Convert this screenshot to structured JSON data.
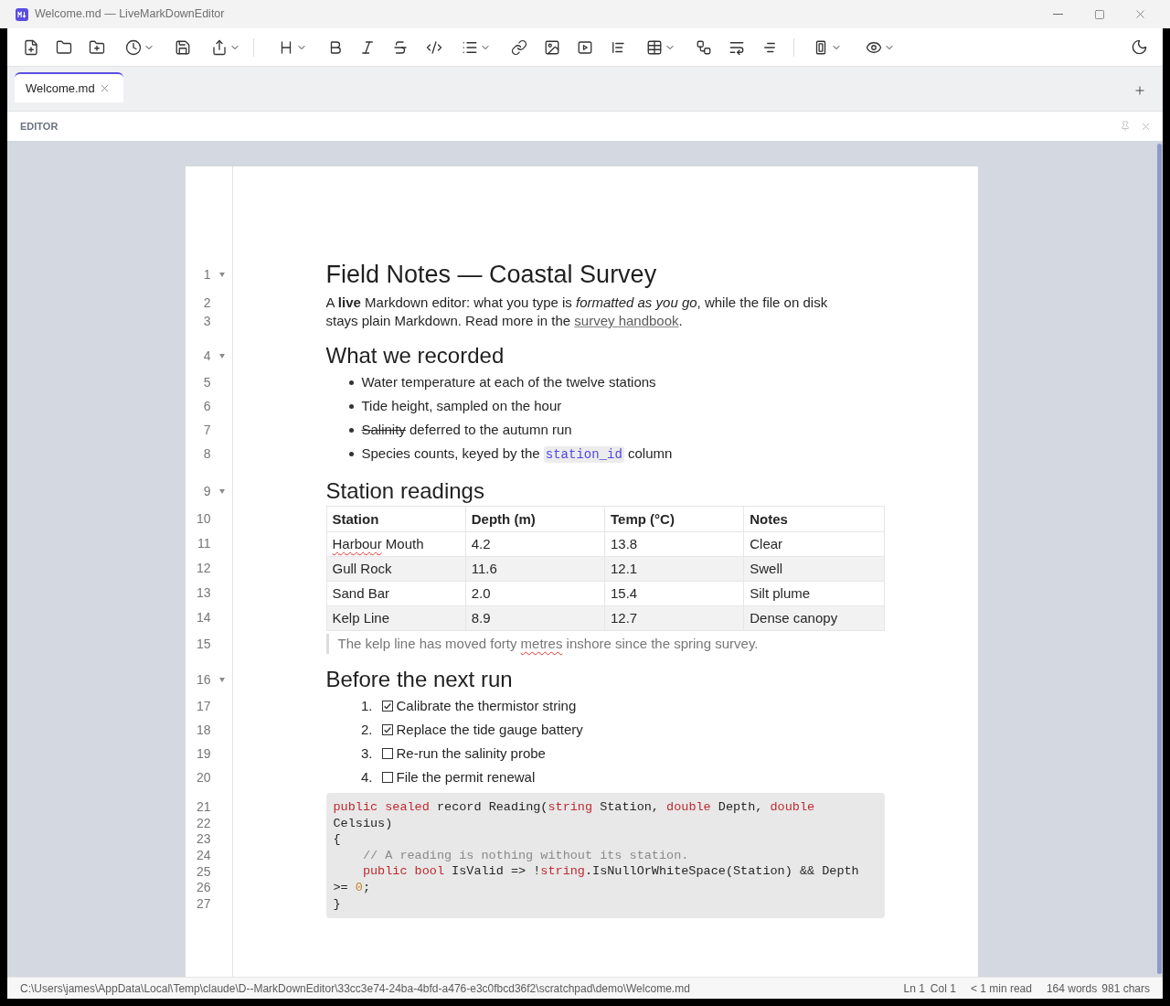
{
  "window": {
    "title": "Welcome.md — LiveMarkDownEditor"
  },
  "tabs": [
    {
      "label": "Welcome.md",
      "selected": true
    }
  ],
  "panel": {
    "title": "EDITOR"
  },
  "document": {
    "blocks": [
      {
        "kind": "heading1",
        "line": "1",
        "expanded": true,
        "text": "Field Notes — Coastal Survey"
      },
      {
        "kind": "paragraph",
        "rows": [
          {
            "line": "2",
            "segments": [
              {
                "kind": "text",
                "text": "A **live** Markdown editor: what you type is *formatted as you go*, while the file on disk"
              }
            ]
          },
          {
            "line": "3",
            "segments": [
              {
                "kind": "text",
                "text": "stays plain Markdown. Read more in the "
              },
              {
                "kind": "link",
                "text": "survey handbook"
              },
              {
                "kind": "text",
                "text": "."
              }
            ]
          }
        ]
      },
      {
        "kind": "heading2",
        "line": "4",
        "expanded": true,
        "text": "What we recorded"
      },
      {
        "kind": "bullet_list",
        "items": [
          {
            "line": "5",
            "segments": [
              {
                "kind": "text",
                "text": "Water temperature at each of the twelve stations"
              }
            ]
          },
          {
            "line": "6",
            "segments": [
              {
                "kind": "text",
                "text": "Tide height, sampled on the hour"
              }
            ]
          },
          {
            "line": "7",
            "segments": [
              {
                "kind": "strike",
                "text": "Salinity"
              },
              {
                "kind": "text",
                "text": " deferred to the autumn run"
              }
            ]
          },
          {
            "line": "8",
            "segments": [
              {
                "kind": "text",
                "text": "Species counts, keyed by the "
              },
              {
                "kind": "code",
                "text": "station_id"
              },
              {
                "kind": "text",
                "text": " column"
              }
            ]
          }
        ]
      },
      {
        "kind": "heading2",
        "line": "9",
        "expanded": true,
        "text": "Station readings"
      },
      {
        "kind": "table",
        "line": "10",
        "columns": [
          "Station",
          "Depth (m)",
          "Temp (°C)",
          "Notes"
        ],
        "rows": [
          {
            "line": "11",
            "cells": [
              [
                {
                  "kind": "misspelled",
                  "text": "Harbour"
                },
                {
                  "kind": "text",
                  "text": " Mouth"
                }
              ],
              "4.2",
              "13.8",
              "Clear"
            ]
          },
          {
            "line": "12",
            "cells": [
              "Gull Rock",
              "11.6",
              "12.1",
              "Swell"
            ]
          },
          {
            "line": "13",
            "cells": [
              "Sand Bar",
              "2.0",
              "15.4",
              "Silt plume"
            ]
          },
          {
            "line": "14",
            "cells": [
              "Kelp Line",
              "8.9",
              "12.7",
              "Dense canopy"
            ]
          }
        ]
      },
      {
        "kind": "quote",
        "line": "15",
        "segments": [
          {
            "kind": "text",
            "text": "The kelp line has moved forty "
          },
          {
            "kind": "misspelled",
            "text": "metres"
          },
          {
            "kind": "text",
            "text": " inshore since the spring survey."
          }
        ]
      },
      {
        "kind": "heading2",
        "line": "16",
        "expanded": true,
        "text": "Before the next run"
      },
      {
        "kind": "task_list",
        "items": [
          {
            "line": "17",
            "number": "1.",
            "checked": true,
            "text": "Calibrate the thermistor string"
          },
          {
            "line": "18",
            "number": "2.",
            "checked": true,
            "text": "Replace the tide gauge battery"
          },
          {
            "line": "19",
            "number": "3.",
            "checked": false,
            "text": "Re-run the salinity probe"
          },
          {
            "line": "20",
            "number": "4.",
            "checked": false,
            "text": "File the permit renewal"
          }
        ]
      },
      {
        "kind": "code",
        "lines": [
          {
            "line": "21",
            "indented": false,
            "tokens": [
              {
                "kind": "keyword",
                "text": "public sealed"
              },
              {
                "kind": "plain",
                "text": " record Reading("
              },
              {
                "kind": "keyword",
                "text": "string"
              },
              {
                "kind": "plain",
                "text": " Station, "
              },
              {
                "kind": "keyword",
                "text": "double"
              },
              {
                "kind": "plain",
                "text": " Depth, "
              },
              {
                "kind": "keyword",
                "text": "double"
              }
            ]
          },
          {
            "line": "22",
            "indented": false,
            "tokens": [
              {
                "kind": "plain",
                "text": "Celsius)"
              }
            ]
          },
          {
            "line": "23",
            "indented": false,
            "tokens": [
              {
                "kind": "plain",
                "text": "{"
              }
            ]
          },
          {
            "line": "24",
            "indented": true,
            "tokens": [
              {
                "kind": "comment",
                "text": "// A reading is nothing without its station."
              }
            ]
          },
          {
            "line": "25",
            "indented": true,
            "tokens": [
              {
                "kind": "keyword",
                "text": "public bool"
              },
              {
                "kind": "plain",
                "text": " IsValid => !"
              },
              {
                "kind": "keyword",
                "text": "string"
              },
              {
                "kind": "plain",
                "text": ".IsNullOrWhiteSpace(Station) && Depth"
              }
            ]
          },
          {
            "line": "26",
            "indented": false,
            "tokens": [
              {
                "kind": "plain",
                "text": ">= "
              },
              {
                "kind": "number",
                "text": "0"
              },
              {
                "kind": "plain",
                "text": ";"
              }
            ]
          },
          {
            "line": "27",
            "indented": false,
            "tokens": [
              {
                "kind": "plain",
                "text": "}"
              }
            ]
          }
        ]
      }
    ]
  },
  "status_bar": {
    "path": "C:\\Users\\james\\AppData\\Local\\Temp\\claude\\D--MarkDownEditor\\33cc3e74-24ba-4bfd-a476-e3c0fbcd36f2\\scratchpad\\demo\\Welcome.md",
    "line": "Ln 1",
    "column": "Col 1",
    "read_time": "< 1 min read",
    "words": "164 words",
    "chars": "981 chars"
  }
}
